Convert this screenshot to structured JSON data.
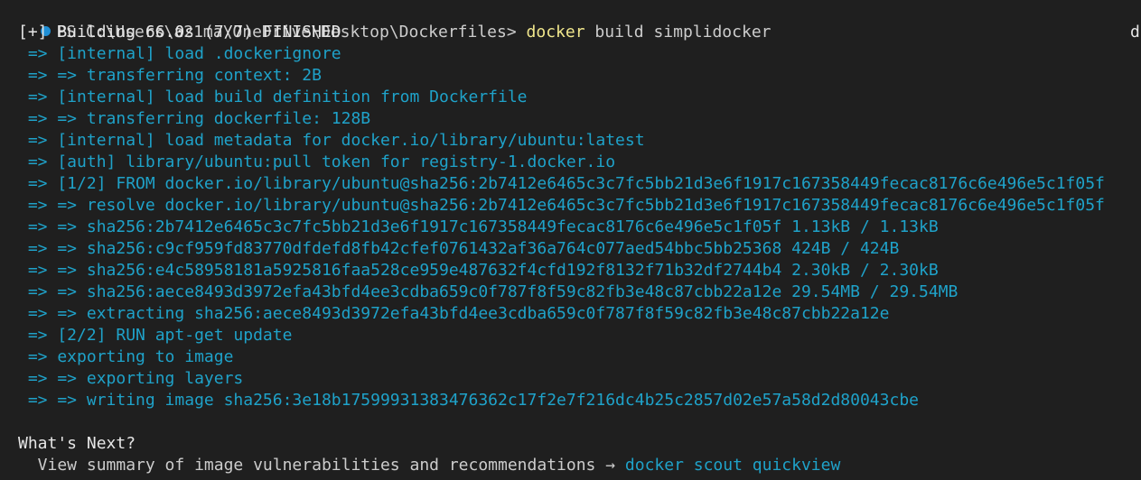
{
  "prompt": {
    "path": "PS C:\\Users\\a21ma\\OneDrive\\Desktop\\Dockerfiles>",
    "command": "docker",
    "args": "build simplidocker"
  },
  "build_header": "[+] Building 66.0s (7/7) FINISHED",
  "clipped_right_text": "d",
  "steps": [
    " => [internal] load .dockerignore",
    " => => transferring context: 2B",
    " => [internal] load build definition from Dockerfile",
    " => => transferring dockerfile: 128B",
    " => [internal] load metadata for docker.io/library/ubuntu:latest",
    " => [auth] library/ubuntu:pull token for registry-1.docker.io",
    " => [1/2] FROM docker.io/library/ubuntu@sha256:2b7412e6465c3c7fc5bb21d3e6f1917c167358449fecac8176c6e496e5c1f05f",
    " => => resolve docker.io/library/ubuntu@sha256:2b7412e6465c3c7fc5bb21d3e6f1917c167358449fecac8176c6e496e5c1f05f",
    " => => sha256:2b7412e6465c3c7fc5bb21d3e6f1917c167358449fecac8176c6e496e5c1f05f 1.13kB / 1.13kB",
    " => => sha256:c9cf959fd83770dfdefd8fb42cfef0761432af36a764c077aed54bbc5bb25368 424B / 424B",
    " => => sha256:e4c58958181a5925816faa528ce959e487632f4cfd192f8132f71b32df2744b4 2.30kB / 2.30kB",
    " => => sha256:aece8493d3972efa43bfd4ee3cdba659c0f787f8f59c82fb3e48c87cbb22a12e 29.54MB / 29.54MB",
    " => => extracting sha256:aece8493d3972efa43bfd4ee3cdba659c0f787f8f59c82fb3e48c87cbb22a12e",
    " => [2/2] RUN apt-get update",
    " => exporting to image",
    " => => exporting layers",
    " => => writing image sha256:3e18b17599931383476362c17f2e7f216dc4b25c2857d02e57a58d2d80043cbe"
  ],
  "whats_next": {
    "heading": "What's Next?",
    "text": "  View summary of image vulnerabilities and recommendations → ",
    "link": "docker scout quickview"
  },
  "colors": {
    "background": "#1f1f1f",
    "text": "#cccccc",
    "command": "#f0e68c",
    "step": "#1fa2c9",
    "prompt_dot": "#1f8fd6"
  }
}
